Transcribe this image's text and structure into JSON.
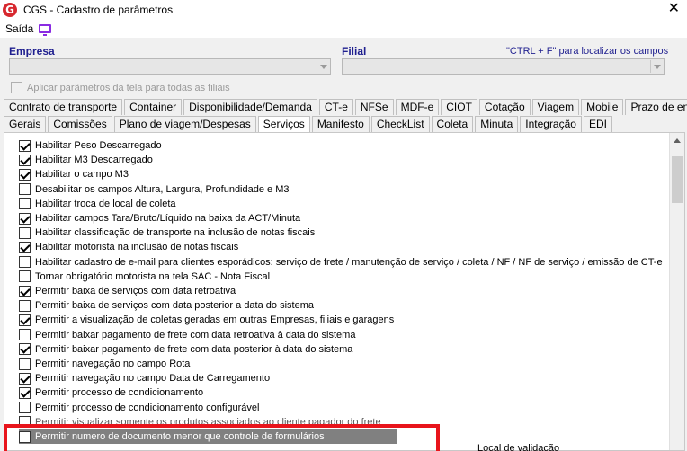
{
  "window": {
    "title": "CGS - Cadastro de parâmetros",
    "logo_letter": "G",
    "close_glyph": "✕"
  },
  "menu": {
    "saida": "Saída"
  },
  "empresa": {
    "label": "Empresa",
    "value": ""
  },
  "filial": {
    "label": "Filial",
    "value": ""
  },
  "search_hint": "\"CTRL + F\" para localizar os campos",
  "apply_all_label": "Aplicar parâmetros da tela para todas as filiais",
  "tabs_row1": [
    "Contrato de transporte",
    "Container",
    "Disponibilidade/Demanda",
    "CT-e",
    "NFSe",
    "MDF-e",
    "CIOT",
    "Cotação",
    "Viagem",
    "Mobile",
    "Prazo de entrega"
  ],
  "tabs_row2": [
    "Gerais",
    "Comissões",
    "Plano de viagem/Despesas",
    "Serviços",
    "Manifesto",
    "CheckList",
    "Coleta",
    "Minuta",
    "Integração",
    "EDI"
  ],
  "active_tab": "Serviços",
  "options": [
    {
      "label": "Habilitar Peso Descarregado",
      "checked": true
    },
    {
      "label": "Habilitar M3 Descarregado",
      "checked": true
    },
    {
      "label": "Habilitar o campo M3",
      "checked": true
    },
    {
      "label": "Desabilitar os campos Altura, Largura, Profundidade e M3",
      "checked": false
    },
    {
      "label": "Habilitar troca de local de coleta",
      "checked": false
    },
    {
      "label": "Habilitar campos Tara/Bruto/Líquido na baixa da ACT/Minuta",
      "checked": true
    },
    {
      "label": "Habilitar classificação de transporte na inclusão de notas fiscais",
      "checked": false
    },
    {
      "label": "Habilitar motorista na inclusão de notas fiscais",
      "checked": true
    },
    {
      "label": "Habilitar cadastro de e-mail para clientes esporádicos: serviço de frete / manutenção de serviço / coleta / NF / NF de serviço / emissão de CT-e",
      "checked": false
    },
    {
      "label": "Tornar obrigatório motorista na tela SAC - Nota Fiscal",
      "checked": false
    },
    {
      "label": "Permitir baixa de serviços com data retroativa",
      "checked": true
    },
    {
      "label": "Permitir baixa de serviços com data posterior a data do sistema",
      "checked": false
    },
    {
      "label": "Permitir a visualização de coletas geradas em outras Empresas, filiais e garagens",
      "checked": true
    },
    {
      "label": "Permitir baixar pagamento de frete com data retroativa à data do sistema",
      "checked": false
    },
    {
      "label": "Permitir baixar pagamento de frete com data posterior à data do sistema",
      "checked": true
    },
    {
      "label": "Permitir navegação no campo Rota",
      "checked": false
    },
    {
      "label": "Permitir navegação no campo Data de Carregamento",
      "checked": true
    },
    {
      "label": "Permitir processo de condicionamento",
      "checked": true
    },
    {
      "label": "Permitir processo de condicionamento configurável",
      "checked": false
    },
    {
      "label": "Permitir visualizar somente os produtos associados ao cliente pagador do frete",
      "checked": false
    },
    {
      "label": "Permitir numero de documento menor que controle de formulários",
      "checked": false
    }
  ],
  "local_validacao_label": "Local de validação",
  "colors": {
    "highlight_border": "#e8141b",
    "selected_row": "#808080",
    "label_blue": "#1f1f8f"
  }
}
